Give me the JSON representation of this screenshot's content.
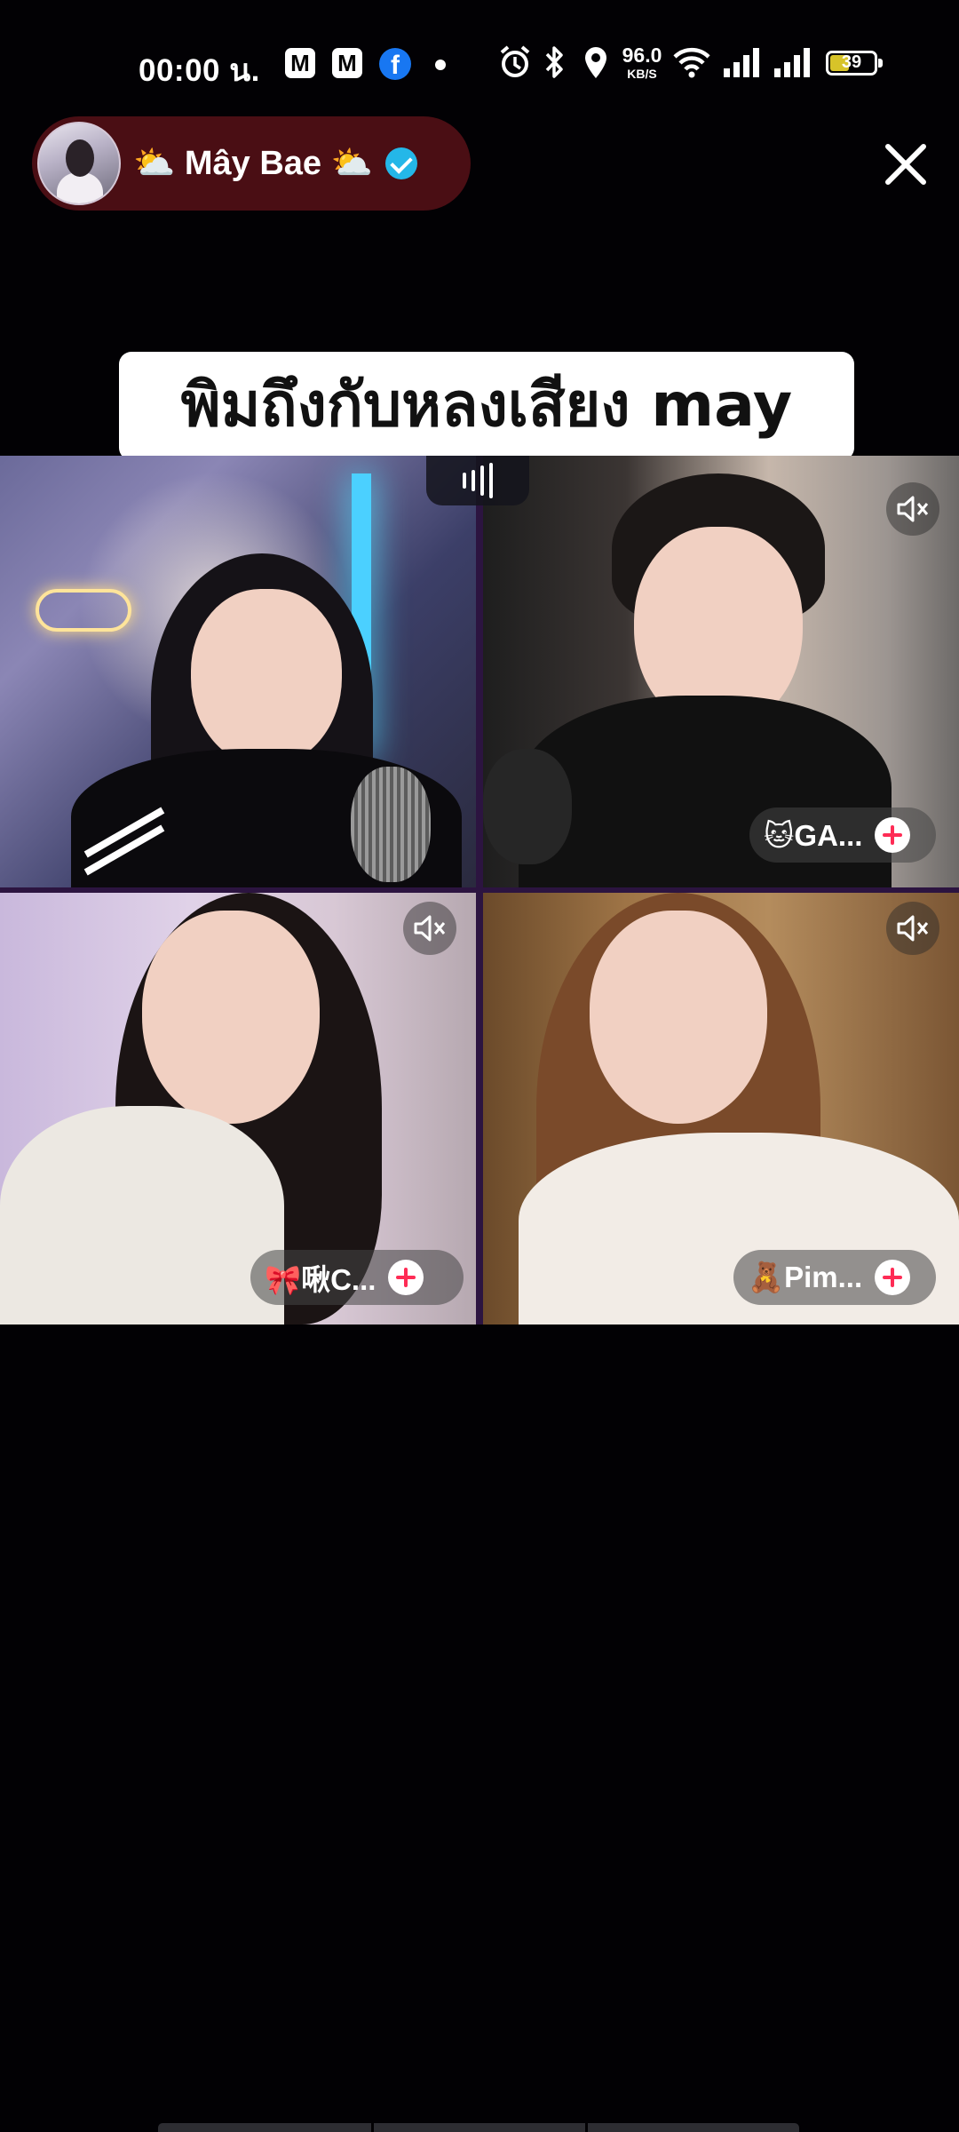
{
  "status_bar": {
    "time": "00:00 น.",
    "app_icons": [
      "M",
      "M",
      "f"
    ],
    "net_speed_value": "96.0",
    "net_speed_unit": "KB/S",
    "battery": "39",
    "icons": [
      "gmail-icon",
      "gmail-icon",
      "facebook-icon",
      "notification-dot-icon",
      "alarm-icon",
      "bluetooth-icon",
      "location-icon",
      "wifi-icon",
      "signal-icon",
      "signal-icon",
      "battery-icon"
    ]
  },
  "host": {
    "name": "⛅ Mây Bae ⛅",
    "verified": true,
    "accent": "#4a0e14",
    "badge_color": "#24b7e8"
  },
  "caption": {
    "text": "พิมถึงกับหลงเสียง may"
  },
  "participants": [
    {
      "label": "",
      "muted": false,
      "speaking": true
    },
    {
      "label": "🐱GA...",
      "muted": true
    },
    {
      "label": "🎀啾C...",
      "muted": true
    },
    {
      "label": "🧸Pim...",
      "muted": true
    }
  ],
  "colors": {
    "background": "#020104",
    "follow_plus": "#fe2c55"
  }
}
